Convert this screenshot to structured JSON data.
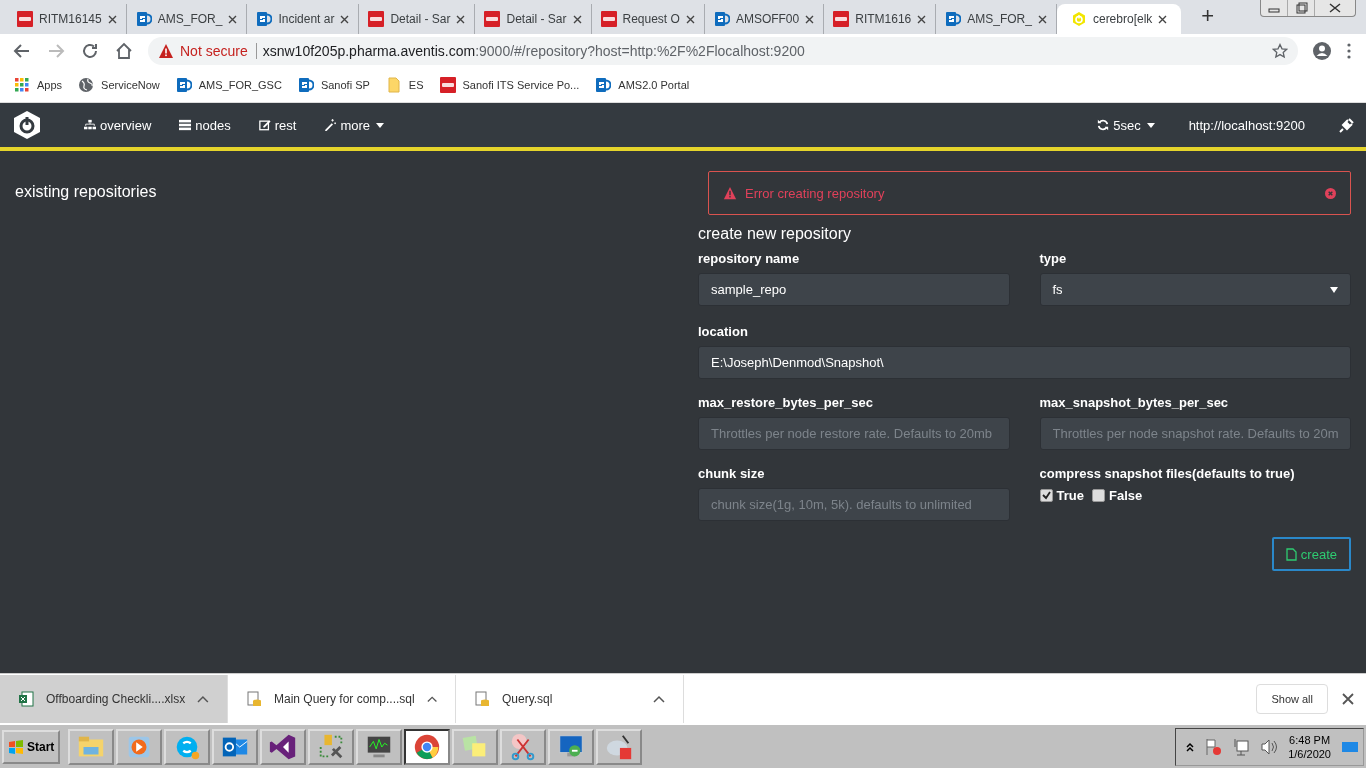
{
  "browser": {
    "tabs": [
      {
        "title": "RITM16145",
        "kind": "now",
        "selected": false
      },
      {
        "title": "AMS_FOR_",
        "kind": "sp",
        "selected": false
      },
      {
        "title": "Incident ar",
        "kind": "sp",
        "selected": false
      },
      {
        "title": "Detail - Sar",
        "kind": "now",
        "selected": false
      },
      {
        "title": "Detail - Sar",
        "kind": "now",
        "selected": false
      },
      {
        "title": "Request O",
        "kind": "now",
        "selected": false
      },
      {
        "title": "AMSOFF00",
        "kind": "sp",
        "selected": false
      },
      {
        "title": "RITM1616",
        "kind": "now",
        "selected": false
      },
      {
        "title": "AMS_FOR_",
        "kind": "sp",
        "selected": false
      },
      {
        "title": "cerebro[elk",
        "kind": "cerebro",
        "selected": true
      }
    ],
    "new_tab": "+",
    "security": "Not secure",
    "url_host": "xsnw10f205p.pharma.aventis.com",
    "url_rest": ":9000/#/repository?host=http:%2F%2Flocalhost:9200",
    "bookmarks": [
      {
        "label": "Apps",
        "kind": "apps"
      },
      {
        "label": "ServiceNow",
        "kind": "globe"
      },
      {
        "label": "AMS_FOR_GSC",
        "kind": "sp"
      },
      {
        "label": "Sanofi SP",
        "kind": "sp"
      },
      {
        "label": "ES",
        "kind": "folder"
      },
      {
        "label": "Sanofi ITS Service Po...",
        "kind": "now"
      },
      {
        "label": "AMS2.0 Portal",
        "kind": "sp"
      }
    ]
  },
  "app": {
    "nav": [
      {
        "label": "overview",
        "kind": "sitemap",
        "dropdown": false
      },
      {
        "label": "nodes",
        "kind": "server",
        "dropdown": false
      },
      {
        "label": "rest",
        "kind": "edit",
        "dropdown": false
      },
      {
        "label": "more",
        "kind": "wand",
        "dropdown": true
      }
    ],
    "refresh": "5sec",
    "host": "http://localhost:9200",
    "left_title": "existing repositories",
    "form": {
      "title": "create new repository",
      "alert": "Error creating repository",
      "repository_name": {
        "label": "repository name",
        "value": "sample_repo"
      },
      "type": {
        "label": "type",
        "value": "fs"
      },
      "location": {
        "label": "location",
        "value": "E:\\Joseph\\Denmod\\Snapshot\\"
      },
      "max_restore": {
        "label": "max_restore_bytes_per_sec",
        "placeholder": "Throttles per node restore rate. Defaults to 20mb"
      },
      "max_snapshot": {
        "label": "max_snapshot_bytes_per_sec",
        "placeholder": "Throttles per node snapshot rate. Defaults to 20m"
      },
      "chunk_size": {
        "label": "chunk size",
        "placeholder": "chunk size(1g, 10m, 5k). defaults to unlimited"
      },
      "compress": {
        "label": "compress snapshot files(defaults to true)",
        "options": [
          {
            "label": "True",
            "checked": true
          },
          {
            "label": "False",
            "checked": false
          }
        ]
      },
      "create": "create"
    }
  },
  "downloads": {
    "items": [
      {
        "name": "Offboarding Checkli....xlsx",
        "kind": "excel",
        "selected": true
      },
      {
        "name": "Main Query for comp....sql",
        "kind": "sql",
        "selected": false
      },
      {
        "name": "Query.sql",
        "kind": "sql",
        "selected": false
      }
    ],
    "show_all": "Show all"
  },
  "taskbar": {
    "start": "Start",
    "apps": [
      {
        "kind": "folder",
        "active": false
      },
      {
        "kind": "media",
        "active": false
      },
      {
        "kind": "chat",
        "active": false
      },
      {
        "kind": "mail",
        "active": false
      },
      {
        "kind": "studio",
        "active": false
      },
      {
        "kind": "tools",
        "active": false
      },
      {
        "kind": "monitor",
        "active": false
      },
      {
        "kind": "browser",
        "active": true
      },
      {
        "kind": "notes",
        "active": false
      },
      {
        "kind": "scissors",
        "active": false
      },
      {
        "kind": "remote",
        "active": false
      },
      {
        "kind": "paint",
        "active": false
      }
    ],
    "time": "6:48 PM",
    "date": "1/6/2020"
  }
}
